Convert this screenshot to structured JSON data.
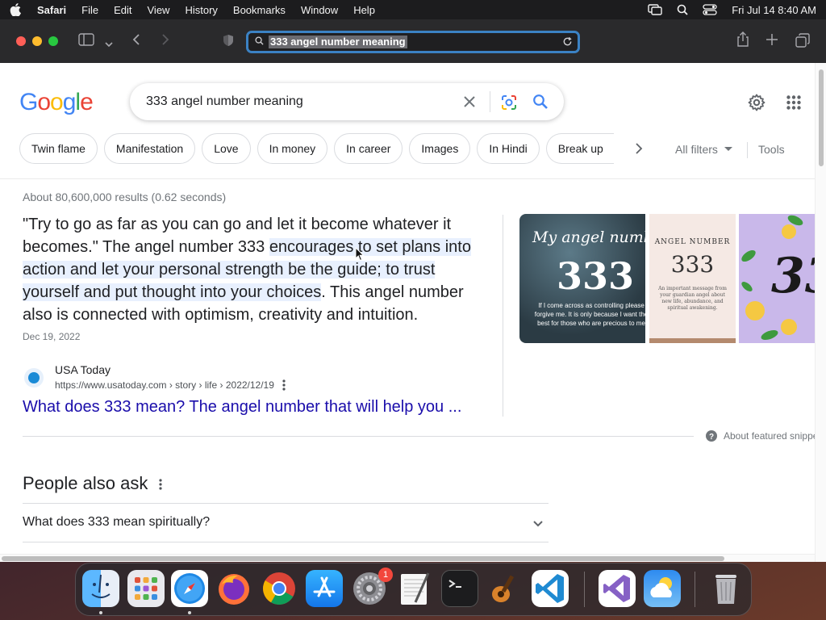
{
  "menubar": {
    "app": "Safari",
    "items": [
      "File",
      "Edit",
      "View",
      "History",
      "Bookmarks",
      "Window",
      "Help"
    ],
    "clock": "Fri Jul 14  8:40 AM"
  },
  "browser": {
    "url": "333 angel number meaning"
  },
  "google": {
    "logo_letters": [
      "G",
      "o",
      "o",
      "g",
      "l",
      "e"
    ],
    "query": "333 angel number meaning",
    "chips": [
      "Twin flame",
      "Manifestation",
      "Love",
      "In money",
      "In career",
      "Images",
      "In Hindi",
      "Break up"
    ],
    "all_filters": "All filters",
    "tools": "Tools",
    "stats": "About 80,600,000 results (0.62 seconds)",
    "snippet": {
      "part1": "\"Try to go as far as you can go and let it become whatever it becomes.\" The angel number 333 ",
      "highlight": "encourages to set plans into action and let your personal strength be the guide; to trust yourself and put thought into your choices",
      "part2": ". This angel number also is connected with optimism, creativity and intuition.",
      "date": "Dec 19, 2022"
    },
    "source": {
      "name": "USA Today",
      "url": "https://www.usatoday.com › story › life › 2022/12/19",
      "title": "What does 333 mean? The angel number that will help you ..."
    },
    "images": {
      "img1_title": "My angel number is",
      "img1_number": "333",
      "img1_caption": "If I come across as controlling please forgive me. It is only because I want the best for those who are precious to me",
      "img2_title": "ANGEL NUMBER",
      "img2_number": "333",
      "img2_caption": "An important message from your guardian angel about new life, abundance, and spiritual awakening.",
      "img3_number": "33"
    },
    "about_featured": "About featured snippets",
    "people_also_ask": {
      "title": "People also ask",
      "questions": [
        "What does 333 mean spiritually?"
      ]
    }
  },
  "dock": {
    "settings_badge": "1",
    "items": [
      "finder-icon",
      "launchpad-icon",
      "safari-icon",
      "firefox-icon",
      "chrome-icon",
      "app-store-icon",
      "system-settings-icon",
      "textedit-icon",
      "terminal-icon",
      "garageband-icon",
      "vscode-icon",
      "visual-studio-icon",
      "weather-icon",
      "trash-icon"
    ]
  },
  "colors": {
    "google_blue": "#4285F4",
    "google_red": "#EA4335",
    "google_yellow": "#FBBC05",
    "google_green": "#34A853",
    "link": "#1a0dab",
    "url_focus_ring": "#3b82c4"
  }
}
